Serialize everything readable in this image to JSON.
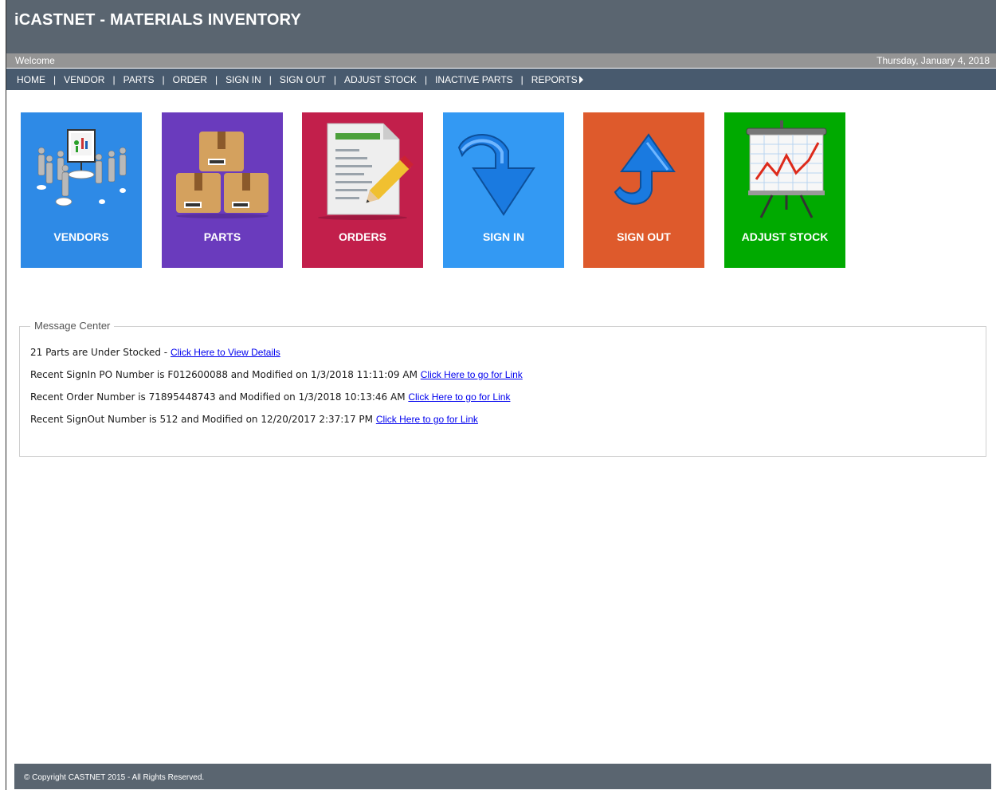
{
  "header": {
    "title": "iCASTNET - MATERIALS INVENTORY"
  },
  "welcome_bar": {
    "welcome": "Welcome",
    "date": "Thursday, January 4, 2018"
  },
  "nav": {
    "items": [
      "HOME",
      "VENDOR",
      "PARTS",
      "ORDER",
      "SIGN IN",
      "SIGN OUT",
      "ADJUST STOCK",
      "INACTIVE PARTS",
      "REPORTS"
    ],
    "separator": "|"
  },
  "tiles": [
    {
      "label": "VENDORS",
      "color": "#2e8ae6",
      "icon": "presentation-people-icon"
    },
    {
      "label": "PARTS",
      "color": "#6a3bbd",
      "icon": "boxes-icon"
    },
    {
      "label": "ORDERS",
      "color": "#c21f4b",
      "icon": "document-pencil-icon"
    },
    {
      "label": "SIGN IN",
      "color": "#3399f3",
      "icon": "arrow-down-icon"
    },
    {
      "label": "SIGN OUT",
      "color": "#de5a2c",
      "icon": "arrow-up-icon"
    },
    {
      "label": "ADJUST STOCK",
      "color": "#00aa00",
      "icon": "chart-board-icon"
    }
  ],
  "message_center": {
    "title": "Message Center",
    "messages": [
      {
        "text": "21 Parts are Under Stocked - ",
        "link": "Click Here to View Details"
      },
      {
        "text": "Recent SignIn PO Number is F012600088 and Modified on 1/3/2018 11:11:09 AM ",
        "link": "Click Here to go for Link"
      },
      {
        "text": "Recent Order Number is 71895448743 and Modified on 1/3/2018 10:13:46 AM ",
        "link": "Click Here to go for Link"
      },
      {
        "text": "Recent SignOut Number is 512 and Modified on 12/20/2017 2:37:17 PM ",
        "link": "Click Here to go for Link"
      }
    ]
  },
  "footer": {
    "copyright": "© Copyright CASTNET 2015 - All Rights Reserved."
  }
}
